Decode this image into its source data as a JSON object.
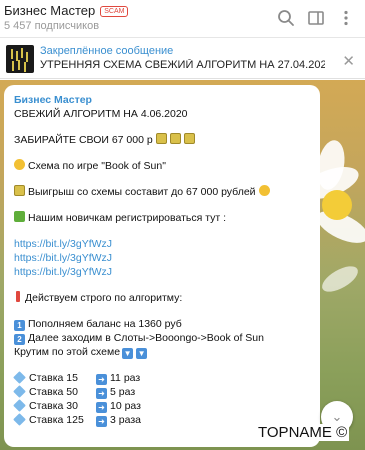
{
  "header": {
    "channel_name": "Бизнес Мастер",
    "scam_badge": "SCAM",
    "subscribers": "5 457 подписчиков",
    "icons": [
      "search-icon",
      "sidebar-toggle-icon",
      "more-vertical-icon"
    ]
  },
  "pinned": {
    "title": "Закреплённое сообщение",
    "text": "УТРЕННЯЯ СХЕМА  СВЕЖИЙ АЛГОРИТМ НА 27.04.2020...",
    "close": "✕"
  },
  "message": {
    "author": "Бизнес Мастер",
    "line1": "СВЕЖИЙ АЛГОРИТМ НА 4.06.2020",
    "line2": "ЗАБИРАЙТЕ СВОИ  67 000 р",
    "line3": "Схема по игре \"Book of Sun\"",
    "line4": "Выигрыш со схемы составит до 67 000 рублей",
    "line5": "Нашим новичкам регистрироваться тут :",
    "links": [
      "https://bit.ly/3gYfWzJ",
      "https://bit.ly/3gYfWzJ",
      "https://bit.ly/3gYfWzJ"
    ],
    "line6": "Действуем строго по алгоритму:",
    "step1": "Пополняем баланс на 1360 руб",
    "step2": "Далее заходим в Слоты->Booongo->Book of Sun",
    "line7": "Крутим по этой схеме",
    "stakes": [
      {
        "stake": "Ставка 15",
        "times": "11 раз"
      },
      {
        "stake": "Ставка 50",
        "times": "5 раз"
      },
      {
        "stake": "Ставка 30",
        "times": "10 раз"
      },
      {
        "stake": "Ставка 125",
        "times": "3 раза"
      }
    ]
  },
  "watermark": "TOPNAME ©",
  "colors": {
    "accent": "#3a8fd0",
    "scam": "#e0483e"
  }
}
